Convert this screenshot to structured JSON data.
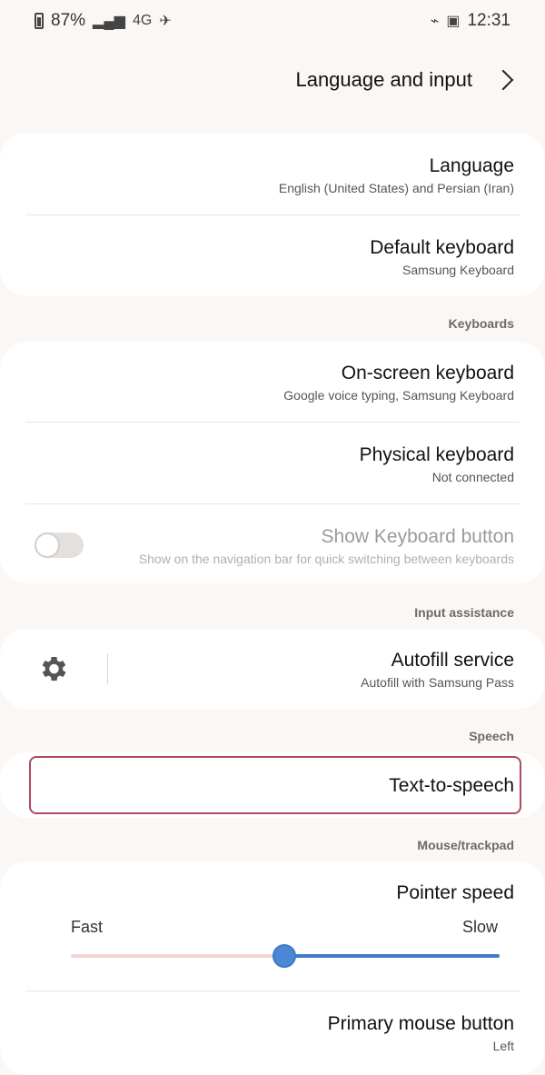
{
  "status_bar": {
    "time": "12:31",
    "battery": "87%",
    "network": "4G"
  },
  "header": {
    "title": "Language and input"
  },
  "general": {
    "language": {
      "title": "Language",
      "subtitle": "English (United States) and Persian (Iran)"
    },
    "default_keyboard": {
      "title": "Default keyboard",
      "subtitle": "Samsung Keyboard"
    }
  },
  "keyboards": {
    "section": "Keyboards",
    "on_screen": {
      "title": "On-screen keyboard",
      "subtitle": "Google voice typing, Samsung Keyboard"
    },
    "physical": {
      "title": "Physical keyboard",
      "subtitle": "Not connected"
    },
    "show_button": {
      "title": "Show Keyboard button",
      "subtitle": "Show on the navigation bar for quick switching between keyboards",
      "enabled": false
    }
  },
  "input_assistance": {
    "section": "Input assistance",
    "autofill": {
      "title": "Autofill service",
      "subtitle": "Autofill with Samsung Pass"
    }
  },
  "speech": {
    "section": "Speech",
    "tts": {
      "title": "Text-to-speech"
    }
  },
  "mouse": {
    "section": "Mouse/trackpad",
    "pointer_speed": {
      "title": "Pointer speed",
      "slow": "Slow",
      "fast": "Fast",
      "value": 0.5
    },
    "primary_button": {
      "title": "Primary mouse button",
      "subtitle": "Left"
    }
  },
  "colors": {
    "accent": "#3f7bc7",
    "highlight": "#b04a5e"
  }
}
